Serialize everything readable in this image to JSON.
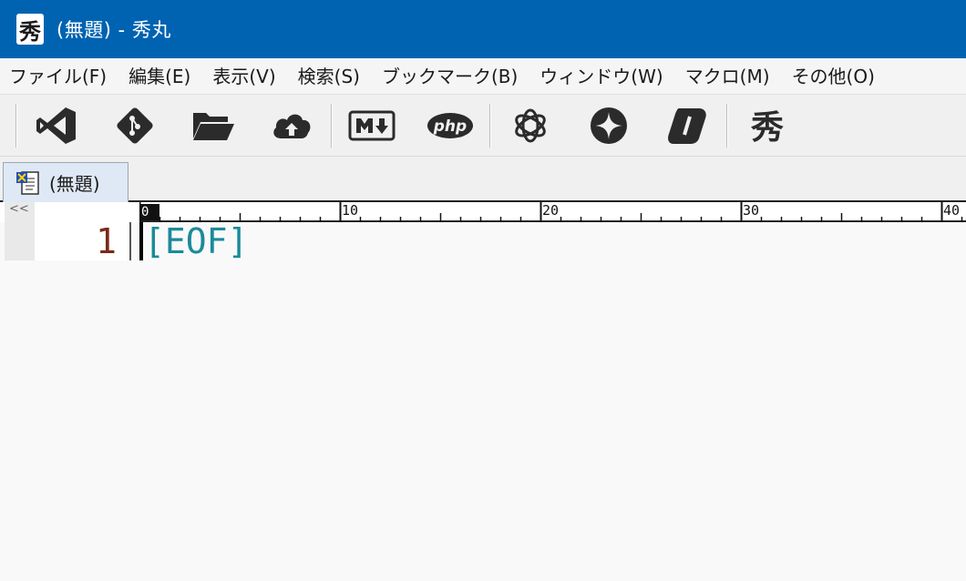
{
  "window": {
    "app_icon_glyph": "秀",
    "title": "(無題) - 秀丸"
  },
  "menu": {
    "items": [
      "ファイル(F)",
      "編集(E)",
      "表示(V)",
      "検索(S)",
      "ブックマーク(B)",
      "ウィンドウ(W)",
      "マクロ(M)",
      "その他(O)"
    ]
  },
  "toolbar": {
    "buttons": [
      {
        "icon": "vscode-icon"
      },
      {
        "icon": "git-icon"
      },
      {
        "icon": "folder-open-icon"
      },
      {
        "icon": "cloud-upload-icon"
      },
      {
        "icon": "markdown-icon",
        "label": "M↓"
      },
      {
        "icon": "php-icon",
        "label": "php"
      },
      {
        "icon": "openai-icon"
      },
      {
        "icon": "gemini-icon"
      },
      {
        "icon": "copilot-icon"
      },
      {
        "icon": "hidemaru-icon",
        "label": "秀"
      }
    ]
  },
  "tab": {
    "label": "(無題)"
  },
  "editor": {
    "ruler_corner": "<<",
    "ruler_zero": "0",
    "ruler_marks": [
      "10",
      "20",
      "30",
      "40"
    ],
    "line_number": "1",
    "eof_marker": "[EOF]"
  },
  "colors": {
    "titlebar": "#0063b1",
    "line_number": "#7a2a1a",
    "eof": "#1a8a9a"
  }
}
